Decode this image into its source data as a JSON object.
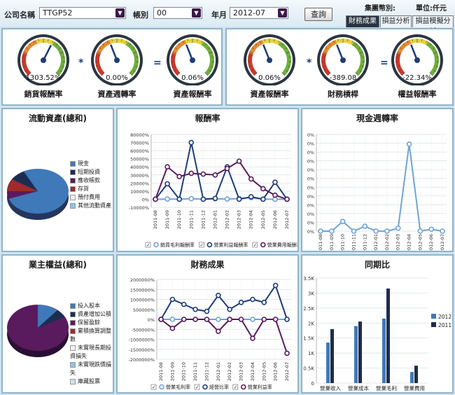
{
  "filters": {
    "company_label": "公司名稱",
    "company_value": "TTGP52",
    "account_label": "帳別",
    "account_value": "00",
    "month_label": "年月",
    "month_value": "2012-07",
    "query_button": "查詢"
  },
  "header": {
    "group_label": "集團幣別:",
    "unit_label": "單位:仟元"
  },
  "tabs": [
    {
      "label": "財務成果",
      "active": true
    },
    {
      "label": "損益分析",
      "active": false
    },
    {
      "label": "損益模擬分析",
      "active": false
    }
  ],
  "gauges_left": [
    {
      "value_text": "1303.52%",
      "label": "銷貨報酬率",
      "fraction": 0.6
    },
    {
      "value_text": "0.00%",
      "label": "資產週轉率",
      "fraction": 0.42
    },
    {
      "value_text": "0.06%",
      "label": "資產報酬率",
      "fraction": 0.42
    }
  ],
  "gauges_right": [
    {
      "value_text": "0.06%",
      "label": "資產報酬率",
      "fraction": 0.42
    },
    {
      "value_text": "-389.08",
      "label": "財務槓桿",
      "fraction": 0.42
    },
    {
      "value_text": "-22.34%",
      "label": "權益報酬率",
      "fraction": 0.42
    }
  ],
  "operators": {
    "times": "*",
    "equals": "="
  },
  "colors": {
    "navy": "#1d3c78",
    "teal": "#2a6f8f",
    "purple": "#5a1a5e",
    "blue": "#3f79b9",
    "lightblue": "#6fa4d6"
  },
  "current_assets": {
    "title": "流動資產(總和)",
    "legend": [
      {
        "label": "現金",
        "color": "#3f79b9"
      },
      {
        "label": "短期投資",
        "color": "#1d2d50"
      },
      {
        "label": "應收帳款",
        "color": "#5a1a5e"
      },
      {
        "label": "存貨",
        "color": "#a12a2a"
      },
      {
        "label": "預付費用",
        "color": "#f3f0f3"
      },
      {
        "label": "其他流動資產",
        "color": "#8cc4ea"
      }
    ]
  },
  "equity": {
    "title": "業主權益(總和)",
    "legend": [
      {
        "label": "投入股本",
        "color": "#3f79b9"
      },
      {
        "label": "資產增加公積",
        "color": "#1d2d50"
      },
      {
        "label": "保留盈餘",
        "color": "#5a1a5e"
      },
      {
        "label": "累積換算調整數",
        "color": "#a12a2a"
      },
      {
        "label": "未實現長期投資損失",
        "color": "#f3f0f3"
      },
      {
        "label": "未實現跌價損失",
        "color": "#8cc4ea"
      },
      {
        "label": "庫藏股票",
        "color": "#c9e2f3"
      }
    ]
  },
  "chart_data": [
    {
      "type": "line",
      "title": "報酬率",
      "categories": [
        "2011-08",
        "2011-09",
        "2011-10",
        "2011-11",
        "2011-12",
        "2012-01",
        "2012-02",
        "2012-03",
        "2012-04",
        "2012-05",
        "2012-06",
        "2012-07"
      ],
      "y_ticks": [
        "80000%",
        "70000%",
        "60000%",
        "50000%",
        "40000%",
        "30000%",
        "20000%",
        "10000%",
        "0%",
        "-10000%"
      ],
      "ylim": [
        -10000,
        80000
      ],
      "series": [
        {
          "name": "銷貨毛利報酬率",
          "color": "#6fa4d6",
          "values": [
            0,
            200,
            0,
            700,
            0,
            600,
            200,
            800,
            2000,
            100,
            0,
            0
          ]
        },
        {
          "name": "營業利益報酬率",
          "color": "#1d3c78",
          "values": [
            0,
            19000,
            0,
            70000,
            0,
            1000,
            40000,
            0,
            3000,
            0,
            21000,
            0
          ]
        },
        {
          "name": "營業費用報酬率",
          "color": "#5a1a5e",
          "values": [
            0,
            40000,
            28000,
            32000,
            31000,
            30000,
            38000,
            47000,
            25000,
            13000,
            5000,
            0
          ]
        }
      ]
    },
    {
      "type": "line",
      "title": "現金週轉率",
      "categories": [
        "2011-08",
        "2011-09",
        "2011-10",
        "2011-11",
        "2011-12",
        "2012-01",
        "2012-02",
        "2012-03",
        "2012-04",
        "2012-05",
        "2012-06",
        "2012-07"
      ],
      "y_ticks": [
        "0%",
        "0%",
        "0%",
        "0%",
        "0%",
        "0%",
        "0%",
        "0%",
        "0%",
        "0%",
        "0%",
        "0%"
      ],
      "ylim": [
        0,
        100
      ],
      "series": [
        {
          "name": "現金週轉率",
          "color": "#6fa4d6",
          "values": [
            0,
            0,
            10,
            0,
            5,
            0,
            0,
            3,
            90,
            0,
            2,
            0
          ]
        }
      ]
    },
    {
      "type": "line",
      "title": "財務成果",
      "categories": [
        "2011-08",
        "2011-09",
        "2011-10",
        "2011-11",
        "2011-12",
        "2012-01",
        "2012-02",
        "2012-03",
        "2012-04",
        "2012-05",
        "2012-06",
        "2012-07"
      ],
      "y_ticks": [
        "2000000%",
        "1500000%",
        "1000000%",
        "500000%",
        "0%",
        "-500000%",
        "-1000000%",
        "-1500000%",
        "-2000000%"
      ],
      "ylim": [
        -2000000,
        2000000
      ],
      "series": [
        {
          "name": "營業毛利率",
          "color": "#6fa4d6",
          "values": [
            0,
            0,
            0,
            0,
            0,
            0,
            0,
            0,
            0,
            0,
            0,
            0
          ]
        },
        {
          "name": "經營比率",
          "color": "#1d3c78",
          "values": [
            0,
            1000000,
            750000,
            500000,
            400000,
            1200000,
            500000,
            850000,
            1000000,
            850000,
            1700000,
            0
          ]
        },
        {
          "name": "營業利益率",
          "color": "#5a1a5e",
          "values": [
            0,
            -450000,
            0,
            0,
            0,
            -600000,
            0,
            0,
            -950000,
            0,
            0,
            -1700000
          ]
        }
      ]
    },
    {
      "type": "bar",
      "title": "同期比",
      "categories": [
        "營業收入",
        "營業成本",
        "營業毛利",
        "營業費用"
      ],
      "y_ticks": [
        "3.5K",
        "3K",
        "2.5K",
        "2K",
        "1.5K",
        "1K",
        "0.5K",
        "0"
      ],
      "ylim": [
        0,
        3500
      ],
      "series": [
        {
          "name": "2012",
          "color": "#3f79b9",
          "values": [
            1350,
            1900,
            2150,
            370
          ]
        },
        {
          "name": "2011",
          "color": "#1d2d50",
          "values": [
            1800,
            2050,
            3150,
            580
          ]
        }
      ]
    }
  ]
}
